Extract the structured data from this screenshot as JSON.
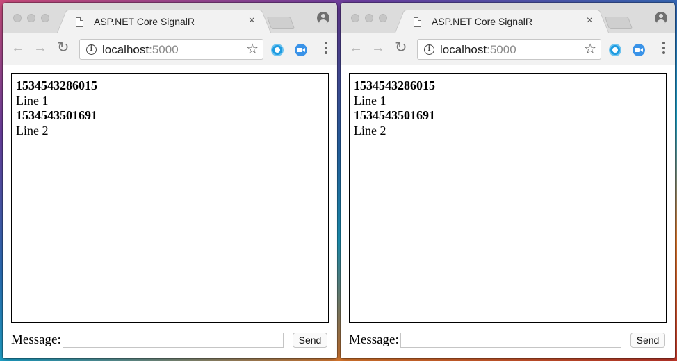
{
  "windows": [
    {
      "tab_title": "ASP.NET Core SignalR",
      "url_host": "localhost",
      "url_port": ":5000",
      "messages": [
        {
          "time": "1534543286015",
          "text": "Line 1"
        },
        {
          "time": "1534543501691",
          "text": "Line 2"
        }
      ],
      "form": {
        "label": "Message:",
        "input_value": "",
        "send_label": "Send"
      }
    },
    {
      "tab_title": "ASP.NET Core SignalR",
      "url_host": "localhost",
      "url_port": ":5000",
      "messages": [
        {
          "time": "1534543286015",
          "text": "Line 1"
        },
        {
          "time": "1534543501691",
          "text": "Line 2"
        }
      ],
      "form": {
        "label": "Message:",
        "input_value": "",
        "send_label": "Send"
      }
    }
  ],
  "icons": {
    "tab_close": "×",
    "back": "←",
    "forward": "→",
    "reload": "↻",
    "star": "☆",
    "info": "i"
  },
  "colors": {
    "extension_1": "#1e9be0",
    "extension_2": "#3a93e8"
  }
}
